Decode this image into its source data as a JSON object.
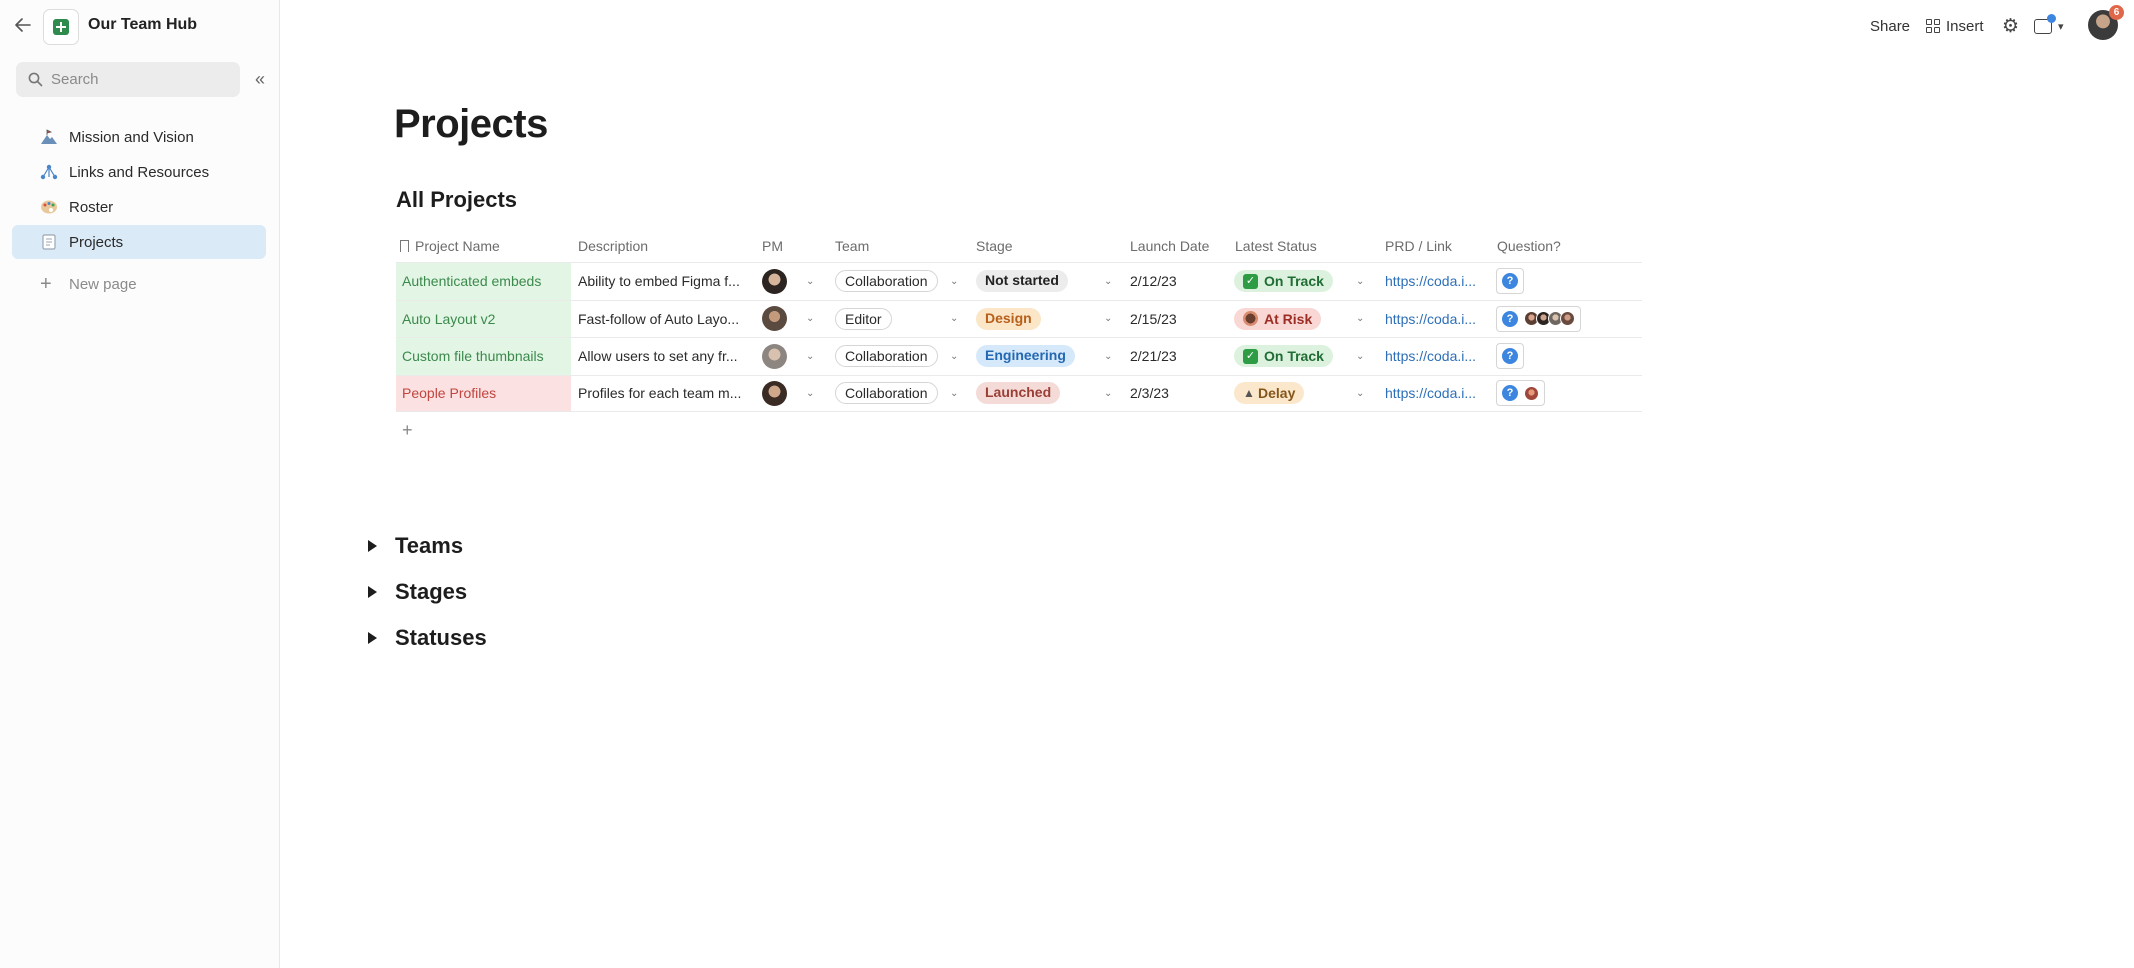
{
  "sidebar": {
    "doc_title": "Our Team Hub",
    "search_placeholder": "Search",
    "items": [
      {
        "label": "Mission and Vision",
        "icon": "mountain-flag-icon"
      },
      {
        "label": "Links and Resources",
        "icon": "network-icon"
      },
      {
        "label": "Roster",
        "icon": "palette-icon"
      },
      {
        "label": "Projects",
        "icon": "document-icon"
      }
    ],
    "new_page_label": "New page"
  },
  "topbar": {
    "share_label": "Share",
    "insert_label": "Insert",
    "notification_count": "6"
  },
  "main": {
    "page_title": "Projects",
    "table_title": "All Projects",
    "columns": [
      "Project Name",
      "Description",
      "PM",
      "Team",
      "Stage",
      "Launch Date",
      "Latest Status",
      "PRD / Link",
      "Question?"
    ],
    "rows": [
      {
        "name": "Authenticated embeds",
        "description": "Ability to embed Figma f...",
        "team": "Collaboration",
        "stage": "Not started",
        "launch_date": "2/12/23",
        "status": "On Track",
        "link": "https://coda.i..."
      },
      {
        "name": "Auto Layout v2",
        "description": "Fast-follow of Auto Layo...",
        "team": "Editor",
        "stage": "Design",
        "launch_date": "2/15/23",
        "status": "At Risk",
        "link": "https://coda.i..."
      },
      {
        "name": "Custom file thumbnails",
        "description": "Allow users to set any fr...",
        "team": "Collaboration",
        "stage": "Engineering",
        "launch_date": "2/21/23",
        "status": "On Track",
        "link": "https://coda.i..."
      },
      {
        "name": "People Profiles",
        "description": "Profiles for each team m...",
        "team": "Collaboration",
        "stage": "Launched",
        "launch_date": "2/3/23",
        "status": "Delay",
        "link": "https://coda.i..."
      }
    ],
    "sections": [
      "Teams",
      "Stages",
      "Statuses"
    ]
  },
  "colors": {
    "active_nav_bg": "#dbeaf7",
    "row_green_bg": "#e3f5e5",
    "row_red_bg": "#fbe1e1",
    "link": "#2d6fb7",
    "question_badge": "#3d86e0"
  }
}
